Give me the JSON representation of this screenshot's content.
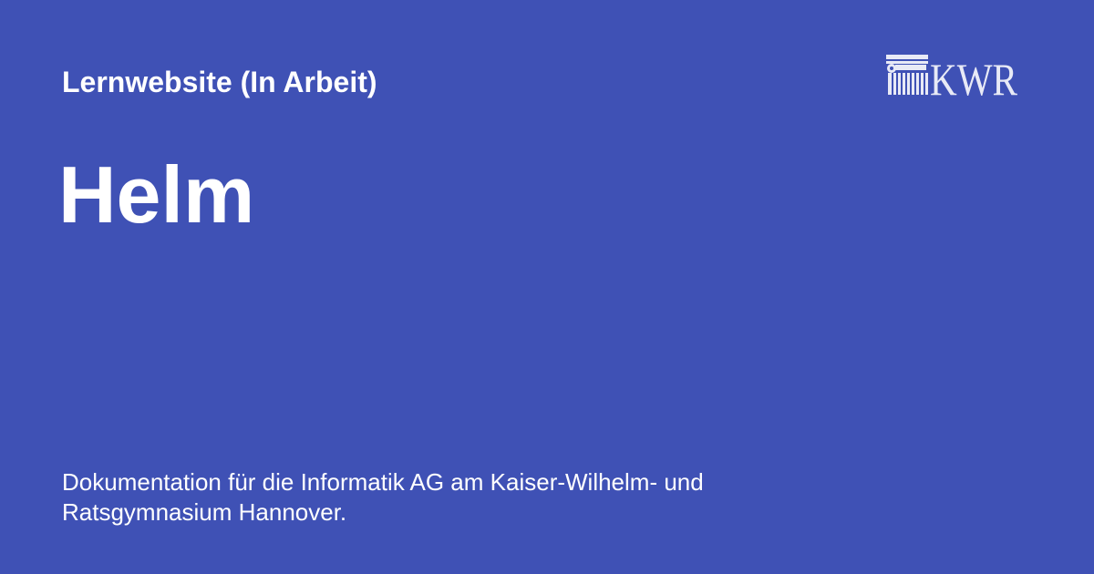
{
  "site": {
    "name": "Lernwebsite (In Arbeit)"
  },
  "page": {
    "title": "Helm",
    "description": "Dokumentation für die Informatik AG am Kaiser-Wilhelm- und Ratsgymnasium Hannover."
  },
  "logo": {
    "text": "KWR",
    "icon": "column-icon",
    "color": "#e8eaf6"
  },
  "colors": {
    "background": "#3f51b5",
    "text": "#ffffff"
  }
}
